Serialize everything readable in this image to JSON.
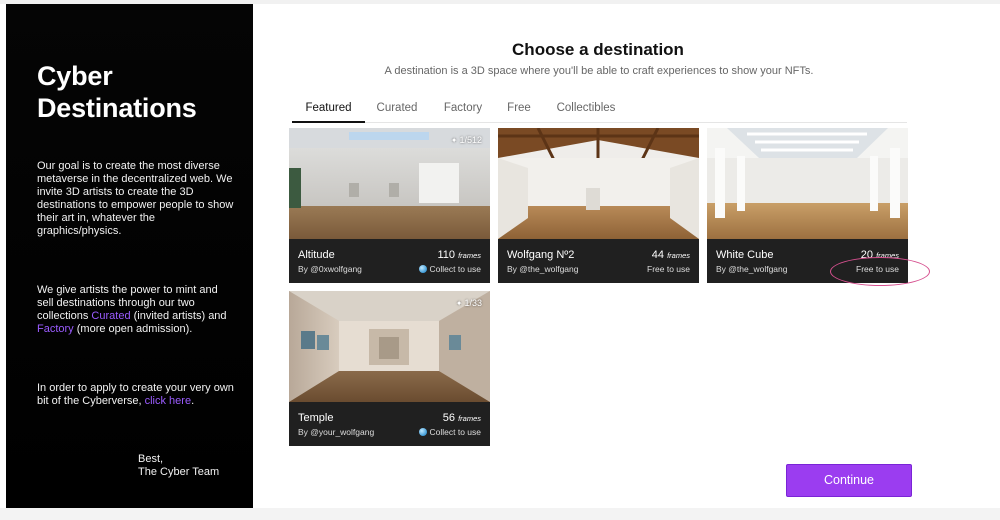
{
  "sidebar": {
    "title_line1": "Cyber",
    "title_line2": "Destinations",
    "intro": "Our goal is to create the most diverse metaverse in the decentralized web. We invite 3D artists to create the 3D destinations to empower people to show their art in, whatever the graphics/physics.",
    "p2_before": "We give artists the power to mint and sell destinations through our two collections ",
    "p2_link1": "Curated",
    "p2_mid": " (invited artists) and ",
    "p2_link2": "Factory",
    "p2_after": " (more open admission).",
    "p3_before": "In order to apply to create your very own bit of the Cyberverse, ",
    "p3_link": "click here",
    "p3_after": ".",
    "sign_line1": "Best,",
    "sign_line2": "The Cyber Team"
  },
  "main": {
    "title": "Choose a destination",
    "subtitle": "A destination is a 3D space where you'll be able to craft experiences to show your NFTs.",
    "tabs": [
      {
        "label": "Featured",
        "active": true
      },
      {
        "label": "Curated",
        "active": false
      },
      {
        "label": "Factory",
        "active": false
      },
      {
        "label": "Free",
        "active": false
      },
      {
        "label": "Collectibles",
        "active": false
      }
    ],
    "frames_unit": "frames",
    "cards": [
      {
        "name": "Altitude",
        "frames": "110",
        "author": "By @0xwolfgang",
        "status": "Collect to use",
        "edition": "1/512",
        "scene": "gallery-hall-icon"
      },
      {
        "name": "Wolfgang Nº2",
        "frames": "44",
        "author": "By @the_wolfgang",
        "status": "Free to use",
        "edition": "",
        "scene": "wooden-roof-hall-icon"
      },
      {
        "name": "White Cube",
        "frames": "20",
        "author": "By @the_wolfgang",
        "status": "Free to use",
        "edition": "",
        "scene": "skylight-gallery-icon"
      },
      {
        "name": "Temple",
        "frames": "56",
        "author": "By @your_wolfgang",
        "status": "Collect to use",
        "edition": "1/33",
        "scene": "temple-corridor-icon"
      }
    ],
    "continue_label": "Continue"
  },
  "colors": {
    "accent": "#9b3df0",
    "link": "#9b5cff",
    "highlight": "#d6508f",
    "sidebar_bg": "#000000",
    "card_info_bg": "#202020"
  }
}
